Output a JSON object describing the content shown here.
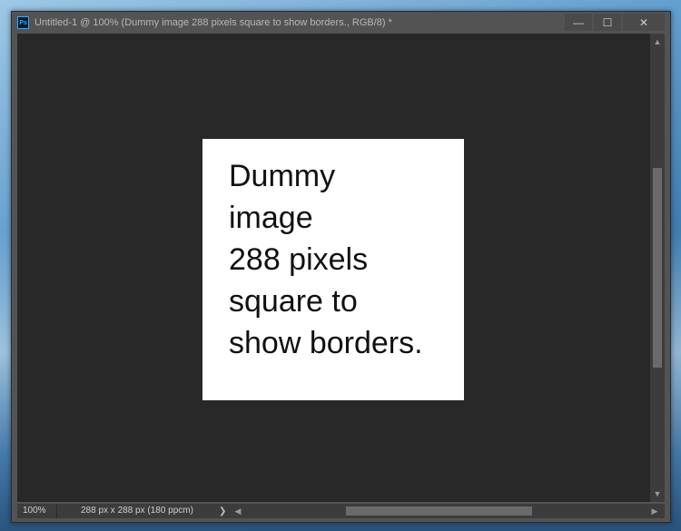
{
  "window": {
    "app_icon": "Ps",
    "title": "Untitled-1 @ 100% (Dummy image 288 pixels square to show borders., RGB/8) *",
    "minimize_glyph": "—",
    "maximize_glyph": "☐",
    "close_glyph": "✕"
  },
  "document": {
    "text": "Dummy\nimage\n288 pixels\nsquare to\nshow borders."
  },
  "status": {
    "zoom": "100%",
    "doc_info": "288 px x 288 px (180 ppcm)",
    "menu_chevron": "❯"
  },
  "scroll": {
    "up": "▲",
    "down": "▼",
    "left": "◀",
    "right": "▶"
  }
}
